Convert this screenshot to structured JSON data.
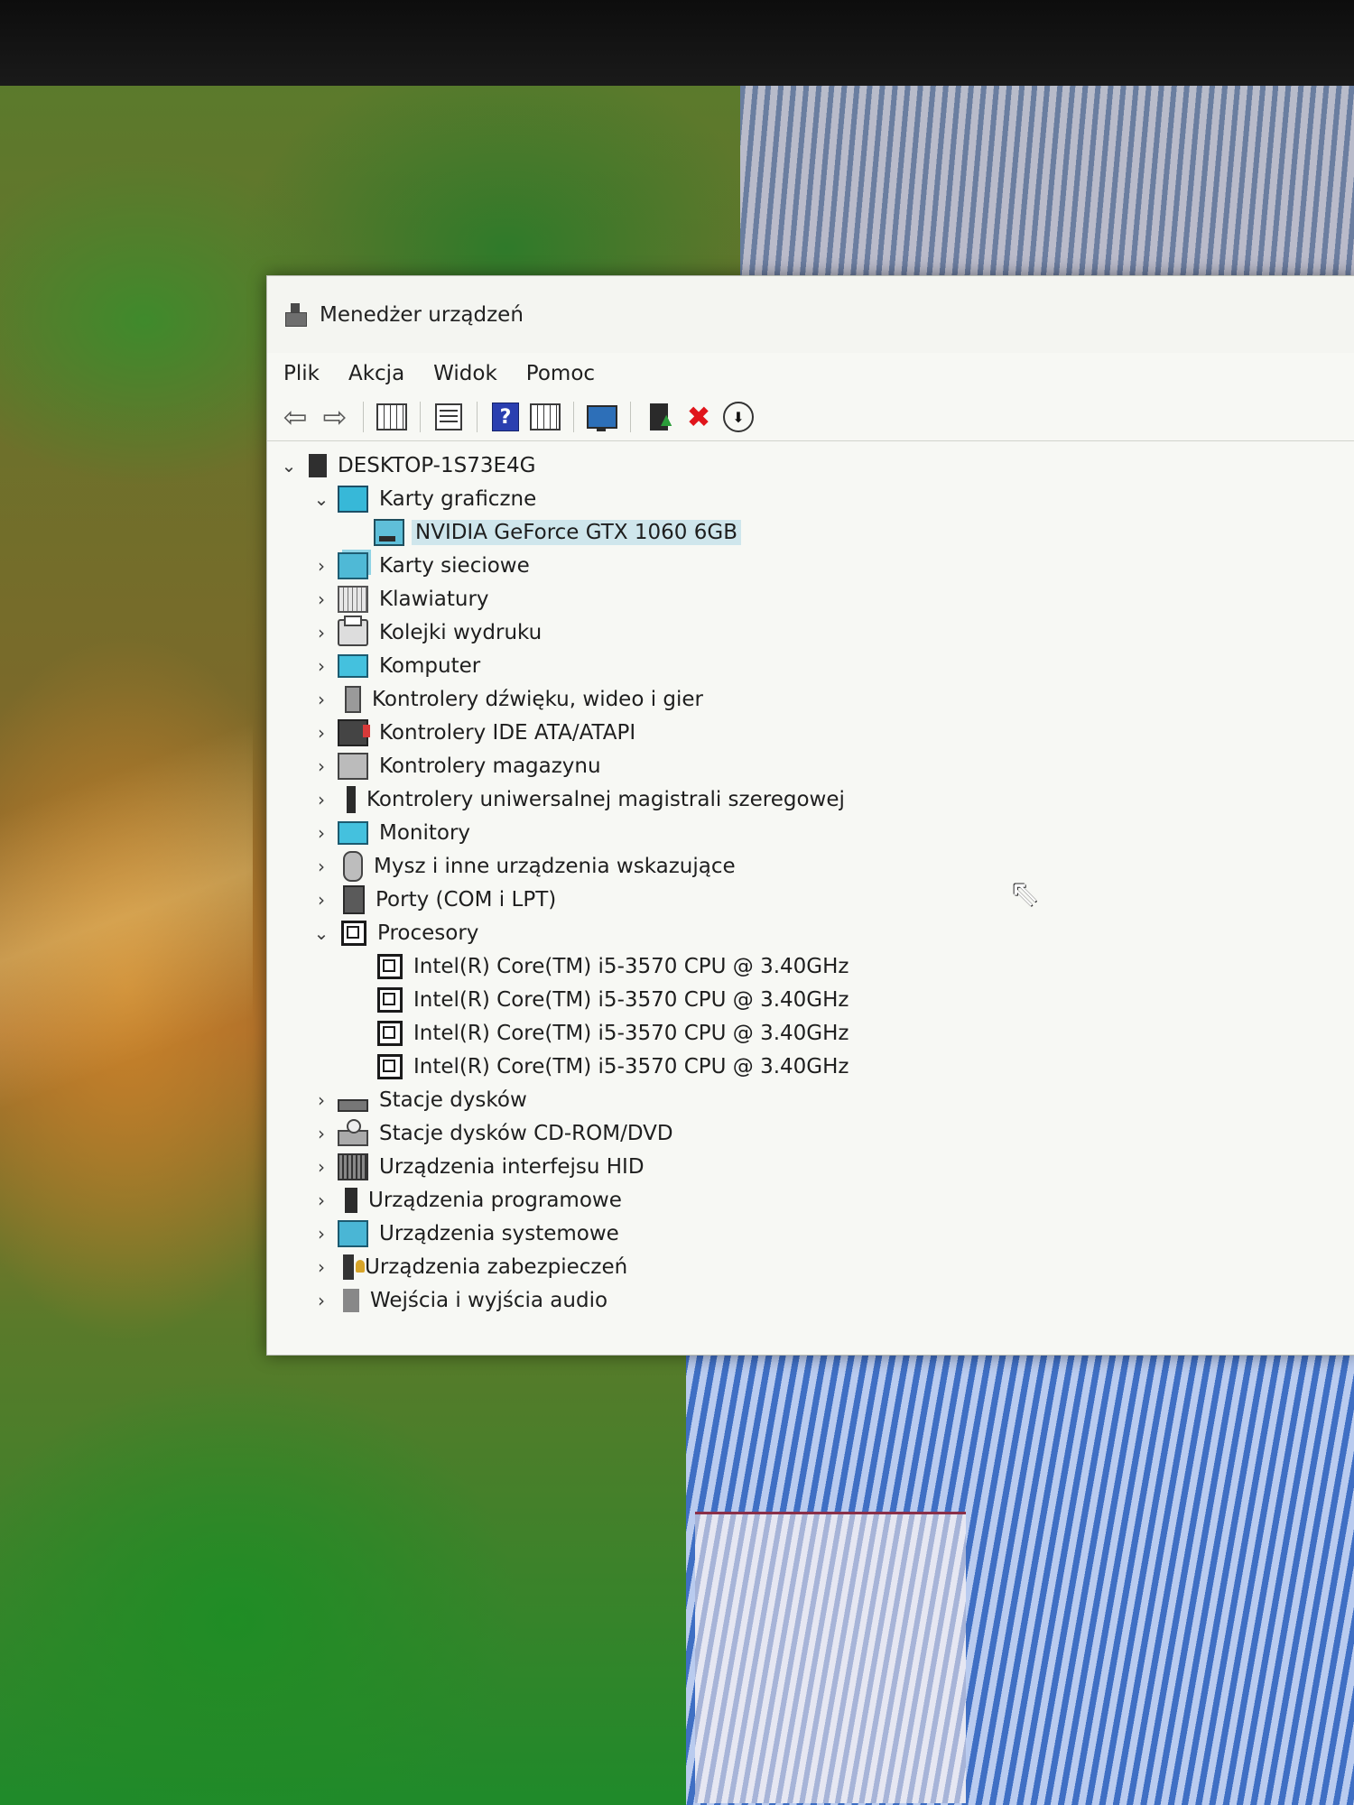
{
  "window": {
    "title": "Menedżer urządzeń"
  },
  "menu": {
    "items": [
      "Plik",
      "Akcja",
      "Widok",
      "Pomoc"
    ]
  },
  "toolbar": {
    "buttons": [
      {
        "icon": "back-arrow-icon"
      },
      {
        "icon": "forward-arrow-icon"
      },
      {
        "icon": "show-hide-tree-icon"
      },
      {
        "icon": "properties-icon"
      },
      {
        "icon": "help-icon",
        "glyph": "?"
      },
      {
        "icon": "view-grid-icon"
      },
      {
        "icon": "scan-hardware-icon"
      },
      {
        "icon": "update-driver-icon"
      },
      {
        "icon": "uninstall-icon"
      },
      {
        "icon": "download-icon"
      }
    ]
  },
  "tree": {
    "root": {
      "label": "DESKTOP-1S73E4G",
      "expanded": true
    },
    "categories": [
      {
        "label": "Karty graficzne",
        "expanded": true,
        "icon": "display-adapter-icon",
        "children": [
          {
            "label": "NVIDIA GeForce GTX 1060 6GB",
            "selected": true
          }
        ]
      },
      {
        "label": "Karty sieciowe",
        "expanded": false,
        "icon": "network-adapter-icon"
      },
      {
        "label": "Klawiatury",
        "expanded": false,
        "icon": "keyboard-icon"
      },
      {
        "label": "Kolejki wydruku",
        "expanded": false,
        "icon": "printer-icon"
      },
      {
        "label": "Komputer",
        "expanded": false,
        "icon": "computer-icon"
      },
      {
        "label": "Kontrolery dźwięku, wideo i gier",
        "expanded": false,
        "icon": "speaker-icon"
      },
      {
        "label": "Kontrolery IDE ATA/ATAPI",
        "expanded": false,
        "icon": "ide-controller-icon"
      },
      {
        "label": "Kontrolery magazynu",
        "expanded": false,
        "icon": "storage-controller-icon"
      },
      {
        "label": "Kontrolery uniwersalnej magistrali szeregowej",
        "expanded": false,
        "icon": "usb-icon"
      },
      {
        "label": "Monitory",
        "expanded": false,
        "icon": "monitor-icon"
      },
      {
        "label": "Mysz i inne urządzenia wskazujące",
        "expanded": false,
        "icon": "mouse-icon"
      },
      {
        "label": "Porty (COM i LPT)",
        "expanded": false,
        "icon": "port-icon"
      },
      {
        "label": "Procesory",
        "expanded": true,
        "icon": "processor-icon",
        "children": [
          {
            "label": "Intel(R) Core(TM) i5-3570 CPU @ 3.40GHz"
          },
          {
            "label": "Intel(R) Core(TM) i5-3570 CPU @ 3.40GHz"
          },
          {
            "label": "Intel(R) Core(TM) i5-3570 CPU @ 3.40GHz"
          },
          {
            "label": "Intel(R) Core(TM) i5-3570 CPU @ 3.40GHz"
          }
        ]
      },
      {
        "label": "Stacje dysków",
        "expanded": false,
        "icon": "disk-drive-icon"
      },
      {
        "label": "Stacje dysków CD-ROM/DVD",
        "expanded": false,
        "icon": "cdrom-icon"
      },
      {
        "label": "Urządzenia interfejsu HID",
        "expanded": false,
        "icon": "hid-icon"
      },
      {
        "label": "Urządzenia programowe",
        "expanded": false,
        "icon": "software-device-icon"
      },
      {
        "label": "Urządzenia systemowe",
        "expanded": false,
        "icon": "system-device-icon"
      },
      {
        "label": "Urządzenia zabezpieczeń",
        "expanded": false,
        "icon": "security-device-icon"
      },
      {
        "label": "Wejścia i wyjścia audio",
        "expanded": false,
        "icon": "audio-io-icon"
      }
    ]
  },
  "colors": {
    "selection": "#cfe6ec",
    "window_bg": "#f7f8f4"
  }
}
